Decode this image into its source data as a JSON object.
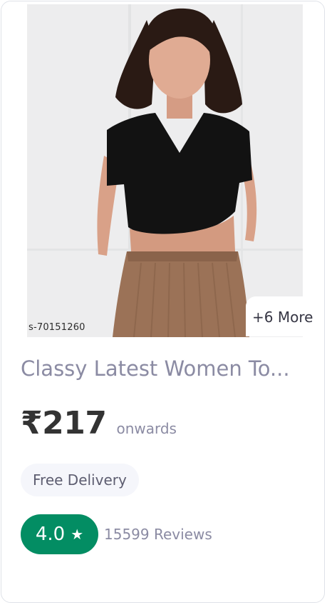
{
  "product": {
    "image_label": "Model wearing black v-neck wrap crop top with brown knit skirt",
    "watermark": "s-70151260",
    "more_images": "+6 More",
    "title": "Classy Latest Women To...",
    "price": "₹217",
    "price_suffix": "onwards",
    "delivery": "Free Delivery",
    "rating": "4.0",
    "reviews": "15599 Reviews"
  },
  "colors": {
    "rating_badge": "#038d63",
    "title_text": "#8b8ba3",
    "price_text": "#333333",
    "chip_background": "#f5f6fb"
  },
  "icons": {
    "rating_star": "star-icon"
  }
}
